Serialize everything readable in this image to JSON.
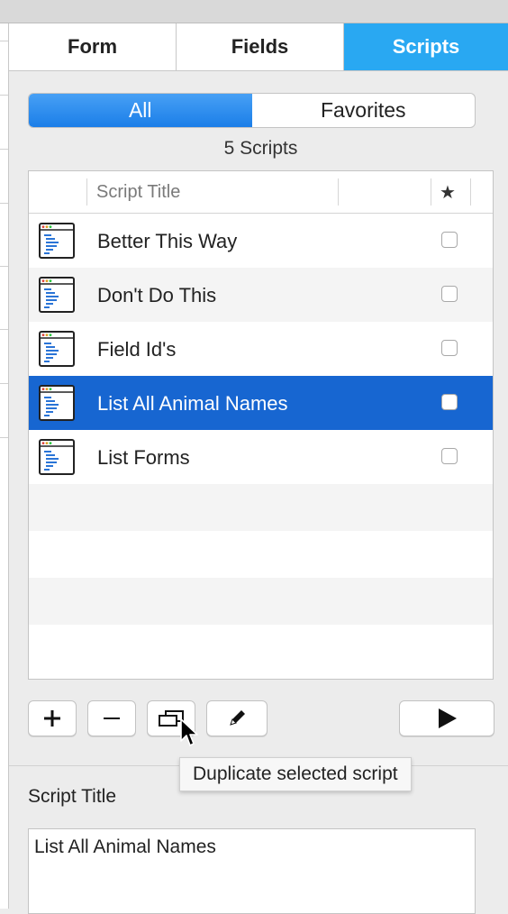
{
  "tabs": [
    {
      "label": "Form",
      "active": false
    },
    {
      "label": "Fields",
      "active": false
    },
    {
      "label": "Scripts",
      "active": true
    }
  ],
  "filter": {
    "options": [
      {
        "label": "All",
        "active": true
      },
      {
        "label": "Favorites",
        "active": false
      }
    ]
  },
  "count_label": "5 Scripts",
  "table": {
    "header": {
      "title": "Script Title",
      "favorite_glyph": "★"
    },
    "rows": [
      {
        "title": "Better This Way",
        "favorite": false,
        "selected": false
      },
      {
        "title": "Don't Do This",
        "favorite": false,
        "selected": false
      },
      {
        "title": "Field Id's",
        "favorite": false,
        "selected": false
      },
      {
        "title": "List All Animal Names",
        "favorite": false,
        "selected": true
      },
      {
        "title": "List Forms",
        "favorite": false,
        "selected": false
      }
    ]
  },
  "toolbar": {
    "add_icon": "plus-icon",
    "remove_icon": "minus-icon",
    "duplicate_icon": "duplicate-icon",
    "edit_icon": "pencil-icon",
    "run_icon": "play-icon"
  },
  "tooltip": "Duplicate selected script",
  "detail": {
    "label": "Script Title",
    "value": "List All Animal Names"
  },
  "colors": {
    "tab_active": "#29a8f2",
    "segment_active": "#1b7ee8",
    "selection": "#1766d1"
  }
}
